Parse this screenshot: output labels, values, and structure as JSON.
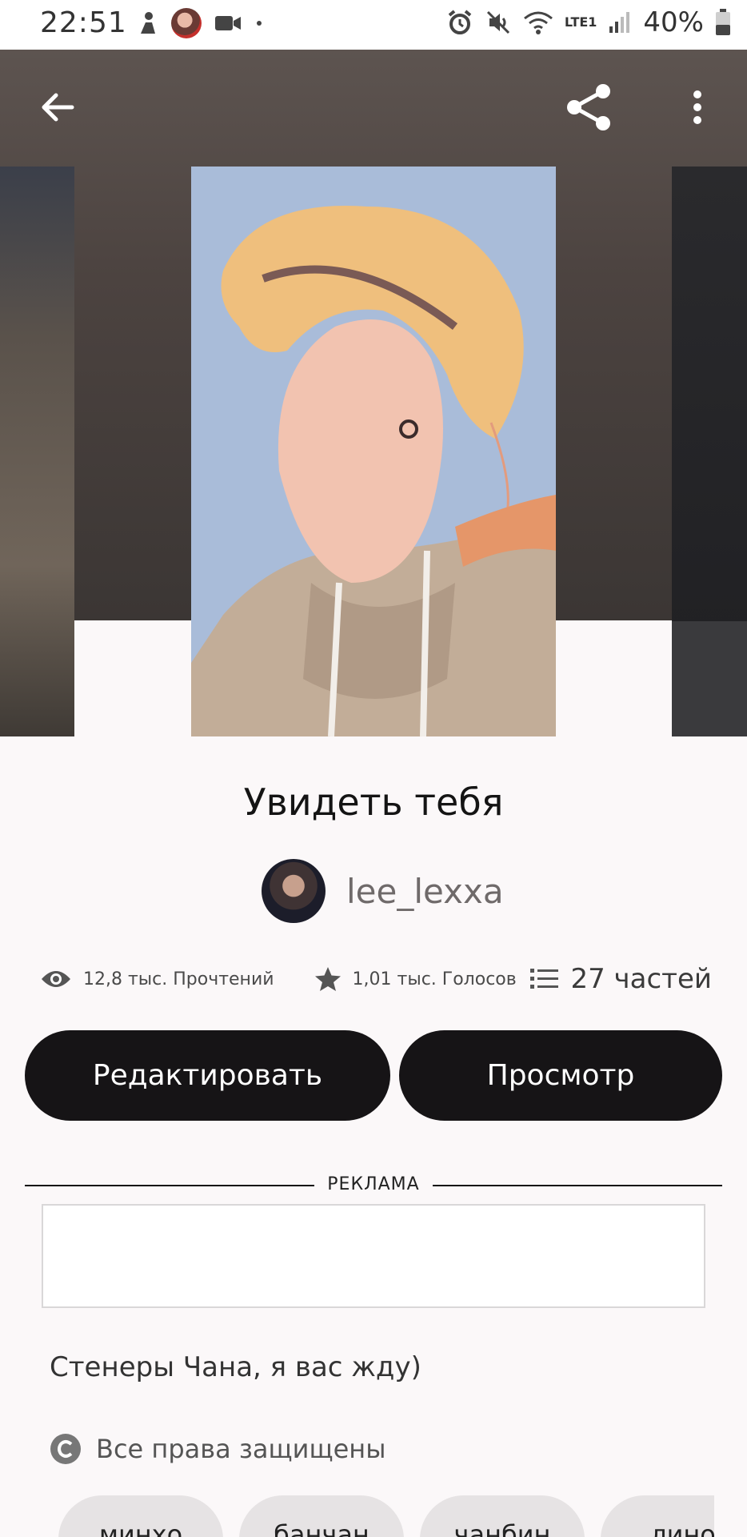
{
  "status_bar": {
    "time": "22:51",
    "battery": "40%",
    "network": "LTE1",
    "icons": [
      "figure-icon",
      "avatar",
      "video-icon",
      "dot",
      "alarm-icon",
      "mute-icon",
      "wifi-icon",
      "signal-icon",
      "battery-icon"
    ]
  },
  "header": {
    "back_icon": "arrow-left-icon",
    "share_icon": "share-icon",
    "menu_icon": "more-vertical-icon"
  },
  "story": {
    "title": "Увидеть тебя",
    "author": "lee_lexxa",
    "reads": "12,8 тыс. Прочтений",
    "votes": "1,01 тыс. Голосов",
    "parts": "27 частей",
    "description": "Стенеры Чана, я вас жду)",
    "copyright": "Все права защищены"
  },
  "buttons": {
    "edit": "Редактировать",
    "view": "Просмотр"
  },
  "ad": {
    "label": "РЕКЛАМА"
  },
  "tags": [
    "минхо",
    "банчан",
    "чанбин",
    "лино"
  ],
  "colors": {
    "button_bg": "#161416",
    "header_bg": "#4c4340",
    "page_bg": "#fbf8f9"
  }
}
